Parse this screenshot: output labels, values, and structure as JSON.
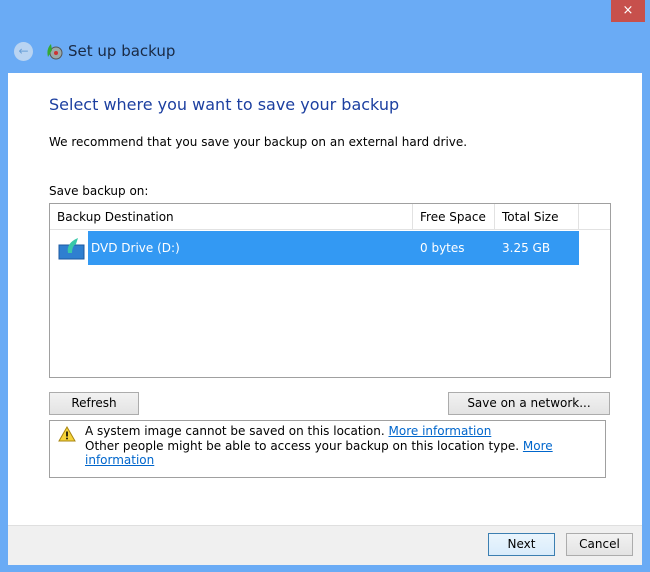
{
  "window": {
    "title": "Set up backup",
    "close_glyph": "×"
  },
  "heading": "Select where you want to save your backup",
  "recommendation": "We recommend that you save your backup on an external hard drive.",
  "save_label": "Save backup on:",
  "table": {
    "columns": [
      "Backup Destination",
      "Free Space",
      "Total Size"
    ],
    "rows": [
      {
        "destination": "DVD Drive (D:)",
        "free": "0 bytes",
        "total": "3.25 GB",
        "selected": true
      }
    ]
  },
  "buttons": {
    "refresh": "Refresh",
    "network": "Save on a network...",
    "next": "Next",
    "cancel": "Cancel"
  },
  "warnings": [
    {
      "text": "A system image cannot be saved on this location.",
      "link": "More information"
    },
    {
      "text": "Other people might be able to access your backup on this location type.",
      "link": "More information"
    }
  ],
  "colors": {
    "accent": "#6aabf5",
    "selection": "#3399f3",
    "heading": "#1c3fa0"
  }
}
